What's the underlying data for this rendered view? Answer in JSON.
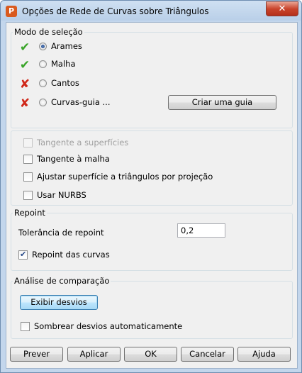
{
  "window": {
    "title": "Opções de Rede de Curvas sobre Triângulos",
    "close_label": "✕",
    "app_icon_letter": "P"
  },
  "selection_mode": {
    "label": "Modo de seleção",
    "options": [
      {
        "label": "Arames",
        "selected": true,
        "status_icon": "green-check-icon"
      },
      {
        "label": "Malha",
        "selected": false,
        "status_icon": "green-check-icon"
      },
      {
        "label": "Cantos",
        "selected": false,
        "status_icon": "red-x-icon"
      },
      {
        "label": "Curvas-guia ...",
        "selected": false,
        "status_icon": "red-x-icon"
      }
    ],
    "create_guide_button": "Criar uma guia"
  },
  "options": {
    "tangent_surfaces": {
      "label": "Tangente a superfícies",
      "checked": false,
      "enabled": false
    },
    "tangent_mesh": {
      "label": "Tangente à malha",
      "checked": false,
      "enabled": true
    },
    "fit_surface": {
      "label": "Ajustar superfície a triângulos por projeção",
      "checked": false,
      "enabled": true
    },
    "use_nurbs": {
      "label": "Usar NURBS",
      "checked": false,
      "enabled": true
    }
  },
  "repoint": {
    "label": "Repoint",
    "tolerance_label": "Tolerância de repoint",
    "tolerance_value": "0,2",
    "repoint_curves": {
      "label": "Repoint das curvas",
      "checked": true
    }
  },
  "comparison": {
    "label": "Análise de comparação",
    "show_deviations_button": "Exibir desvios",
    "shade_deviations": {
      "label": "Sombrear desvios automaticamente",
      "checked": false
    }
  },
  "footer": {
    "preview": "Prever",
    "apply": "Aplicar",
    "ok": "OK",
    "cancel": "Cancelar",
    "help": "Ajuda"
  },
  "colors": {
    "check_green": "#3aa52a",
    "x_red": "#d0281a",
    "close_button": "#c9442c"
  }
}
